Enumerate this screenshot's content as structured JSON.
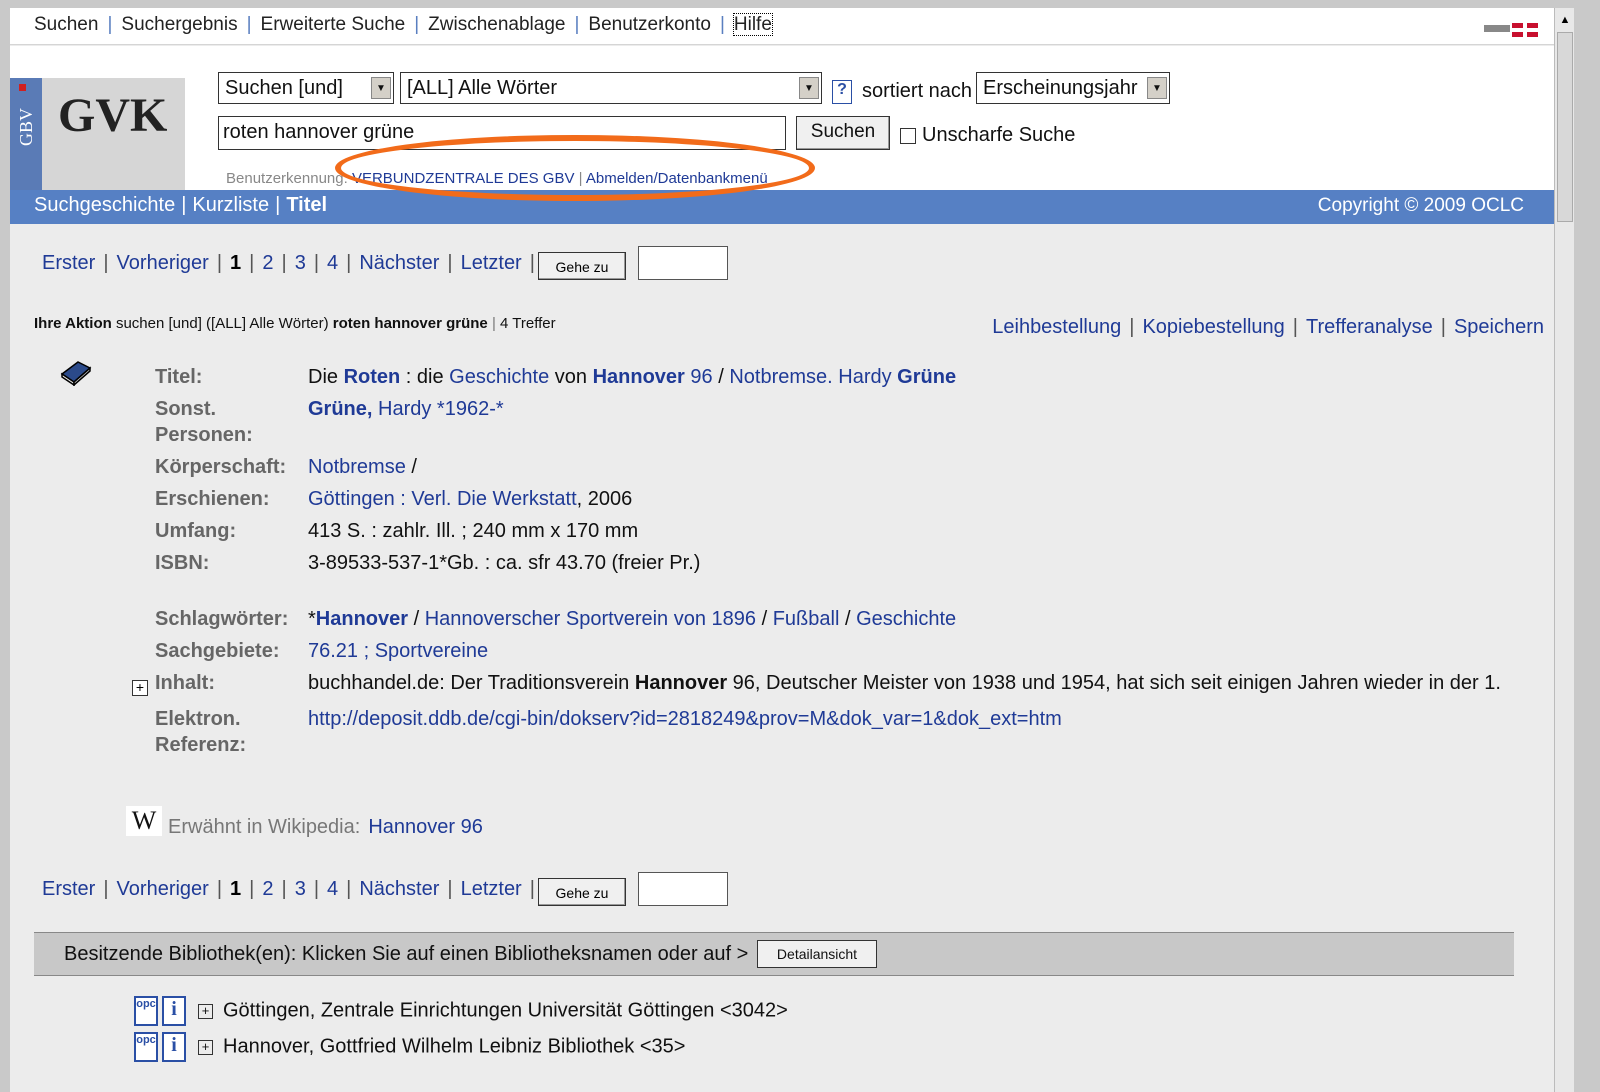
{
  "topnav": {
    "items": [
      "Suchen",
      "Suchergebnis",
      "Erweiterte Suche",
      "Zwischenablage",
      "Benutzerkonto",
      "Hilfe"
    ]
  },
  "logo": {
    "side": "GBV",
    "main": "GVK"
  },
  "search": {
    "operator": "Suchen [und]",
    "index": "[ALL] Alle Wörter",
    "help": "?",
    "sorted_label": "sortiert nach",
    "sort_value": "Erscheinungsjahr",
    "query": "roten hannover grüne",
    "button": "Suchen",
    "fuzzy_label": "Unscharfe Suche",
    "user_label": "Benutzerkennung:",
    "user_value": "VERBUNDZENTRALE DES GBV",
    "logout": "Abmelden/Datenbankmenü"
  },
  "bluebar": {
    "items": [
      "Suchgeschichte",
      "Kurzliste",
      "Titel"
    ],
    "copyright": "Copyright © 2009 OCLC"
  },
  "pager": {
    "first": "Erster",
    "prev": "Vorheriger",
    "current": "1",
    "pages": [
      "2",
      "3",
      "4"
    ],
    "next": "Nächster",
    "last": "Letzter",
    "goto": "Gehe zu"
  },
  "action": {
    "label": "Ihre Aktion",
    "text": "suchen [und] ([ALL] Alle Wörter)",
    "query": "roten hannover grüne",
    "hits": "4 Treffer"
  },
  "actions": [
    "Leihbestellung",
    "Kopiebestellung",
    "Trefferanalyse",
    "Speichern"
  ],
  "record": {
    "labels": {
      "title": "Titel:",
      "persons_1": "Sonst.",
      "persons_2": "Personen:",
      "corp": "Körperschaft:",
      "published": "Erschienen:",
      "extent": "Umfang:",
      "isbn": "ISBN:",
      "subjects": "Schlagwörter:",
      "fields": "Sachgebiete:",
      "contents": "Inhalt:",
      "eref_1": "Elektron.",
      "eref_2": "Referenz:"
    },
    "title": {
      "t1": "Die ",
      "t2": "Roten",
      "t3": " : die ",
      "t4": "Geschichte",
      "t5": " von ",
      "t6": "Hannover",
      "t7": " 96",
      "t8": " / ",
      "t9": "Notbremse. Hardy ",
      "t10": "Grüne"
    },
    "persons": {
      "p1": "Grüne,",
      "p2": " Hardy *1962-*"
    },
    "corp": {
      "c1": "Notbremse",
      "c2": " /"
    },
    "published": {
      "p1": "Göttingen : Verl. Die Werkstatt",
      "p2": ", 2006"
    },
    "extent": "413 S. : zahlr. Ill. ; 240 mm x 170 mm",
    "isbn": "3-89533-537-1*Gb. : ca. sfr 43.70 (freier Pr.)",
    "subjects": {
      "s1": "*",
      "s2": "Hannover",
      "s3": " / ",
      "s4": "Hannoverscher Sportverein von 1896",
      "s5": " / ",
      "s6": "Fußball",
      "s7": " / ",
      "s8": "Geschichte"
    },
    "fields": "76.21 ; Sportvereine",
    "contents": {
      "c1": "buchhandel.de: Der Traditionsverein ",
      "c2": "Hannover",
      "c3": " 96, Deutscher Meister von 1938 und 1954, hat sich seit einigen Jahren wieder in der 1."
    },
    "eref": "http://deposit.ddb.de/cgi-bin/dokserv?id=2818249&prov=M&dok_var=1&dok_ext=htm"
  },
  "wiki": {
    "icon": "W",
    "label": "Erwähnt in Wikipedia:",
    "link": "Hannover 96"
  },
  "holdings": {
    "text": "Besitzende Bibliothek(en): Klicken Sie auf einen Bibliotheksnamen oder auf >",
    "detail_button": "Detailansicht",
    "opc_label": "opc",
    "info_label": "i",
    "libraries": [
      "Göttingen, Zentrale Einrichtungen Universität Göttingen <3042>",
      "Hannover, Gottfried Wilhelm Leibniz Bibliothek <35>"
    ]
  },
  "colors": {
    "accent": "#5680c4",
    "link": "#1f3a96",
    "highlight_oval": "#f26b1a"
  }
}
